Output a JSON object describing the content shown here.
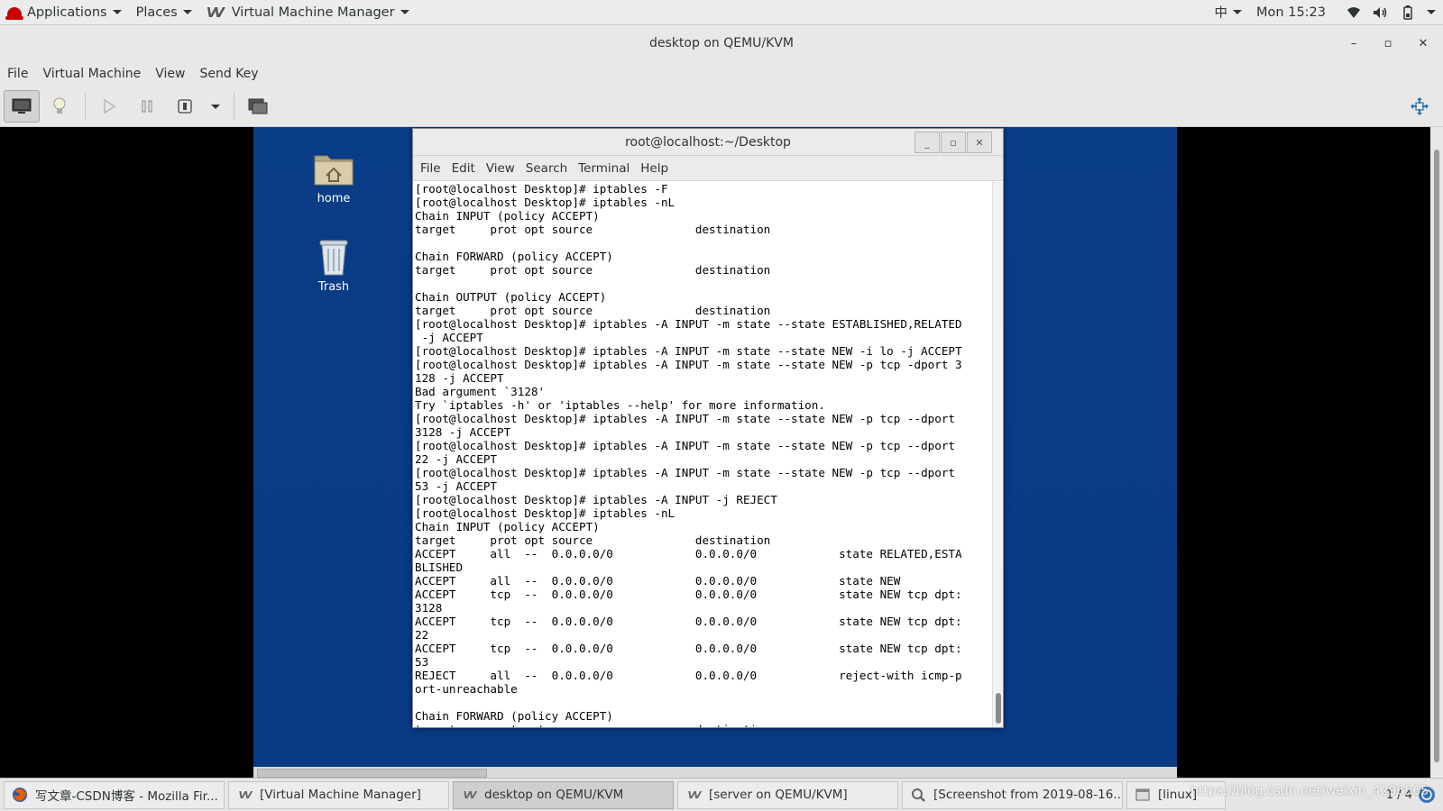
{
  "topbar": {
    "applications": "Applications",
    "places": "Places",
    "app_name": "Virtual Machine Manager",
    "input_method": "中",
    "clock": "Mon 15:23"
  },
  "window": {
    "title": "desktop on QEMU/KVM",
    "minimize": "–",
    "maximize": "▫",
    "close": "✕"
  },
  "menubar": [
    "File",
    "Virtual Machine",
    "View",
    "Send Key"
  ],
  "desktop": {
    "icons": [
      {
        "label": "home"
      },
      {
        "label": "Trash"
      }
    ]
  },
  "terminal": {
    "title": "root@localhost:~/Desktop",
    "menu": [
      "File",
      "Edit",
      "View",
      "Search",
      "Terminal",
      "Help"
    ],
    "lines": [
      "[root@localhost Desktop]# iptables -F",
      "[root@localhost Desktop]# iptables -nL",
      "Chain INPUT (policy ACCEPT)",
      "target     prot opt source               destination",
      "",
      "Chain FORWARD (policy ACCEPT)",
      "target     prot opt source               destination",
      "",
      "Chain OUTPUT (policy ACCEPT)",
      "target     prot opt source               destination",
      "[root@localhost Desktop]# iptables -A INPUT -m state --state ESTABLISHED,RELATED",
      " -j ACCEPT",
      "[root@localhost Desktop]# iptables -A INPUT -m state --state NEW -i lo -j ACCEPT",
      "[root@localhost Desktop]# iptables -A INPUT -m state --state NEW -p tcp -dport 3",
      "128 -j ACCEPT",
      "Bad argument `3128'",
      "Try `iptables -h' or 'iptables --help' for more information.",
      "[root@localhost Desktop]# iptables -A INPUT -m state --state NEW -p tcp --dport",
      "3128 -j ACCEPT",
      "[root@localhost Desktop]# iptables -A INPUT -m state --state NEW -p tcp --dport",
      "22 -j ACCEPT",
      "[root@localhost Desktop]# iptables -A INPUT -m state --state NEW -p tcp --dport",
      "53 -j ACCEPT",
      "[root@localhost Desktop]# iptables -A INPUT -j REJECT",
      "[root@localhost Desktop]# iptables -nL",
      "Chain INPUT (policy ACCEPT)",
      "target     prot opt source               destination",
      "ACCEPT     all  --  0.0.0.0/0            0.0.0.0/0            state RELATED,ESTA",
      "BLISHED",
      "ACCEPT     all  --  0.0.0.0/0            0.0.0.0/0            state NEW",
      "ACCEPT     tcp  --  0.0.0.0/0            0.0.0.0/0            state NEW tcp dpt:",
      "3128",
      "ACCEPT     tcp  --  0.0.0.0/0            0.0.0.0/0            state NEW tcp dpt:",
      "22",
      "ACCEPT     tcp  --  0.0.0.0/0            0.0.0.0/0            state NEW tcp dpt:",
      "53",
      "REJECT     all  --  0.0.0.0/0            0.0.0.0/0            reject-with icmp-p",
      "ort-unreachable",
      "",
      "Chain FORWARD (policy ACCEPT)",
      "target     prot opt source               destination"
    ]
  },
  "taskbar": {
    "tasks": [
      {
        "label": "写文章-CSDN博客 - Mozilla Fir...",
        "icon": "firefox-icon"
      },
      {
        "label": "[Virtual Machine Manager]",
        "icon": "vmm-icon"
      },
      {
        "label": "desktop on QEMU/KVM",
        "icon": "vmm-icon"
      },
      {
        "label": "[server on QEMU/KVM]",
        "icon": "vmm-icon"
      },
      {
        "label": "[Screenshot from 2019-08-16...",
        "icon": "screenshot-icon"
      },
      {
        "label": "[linux]",
        "icon": "window-icon"
      }
    ],
    "pager": "1 / 4"
  },
  "watermark": "https://blog.csdn.net/weixin_4296565"
}
